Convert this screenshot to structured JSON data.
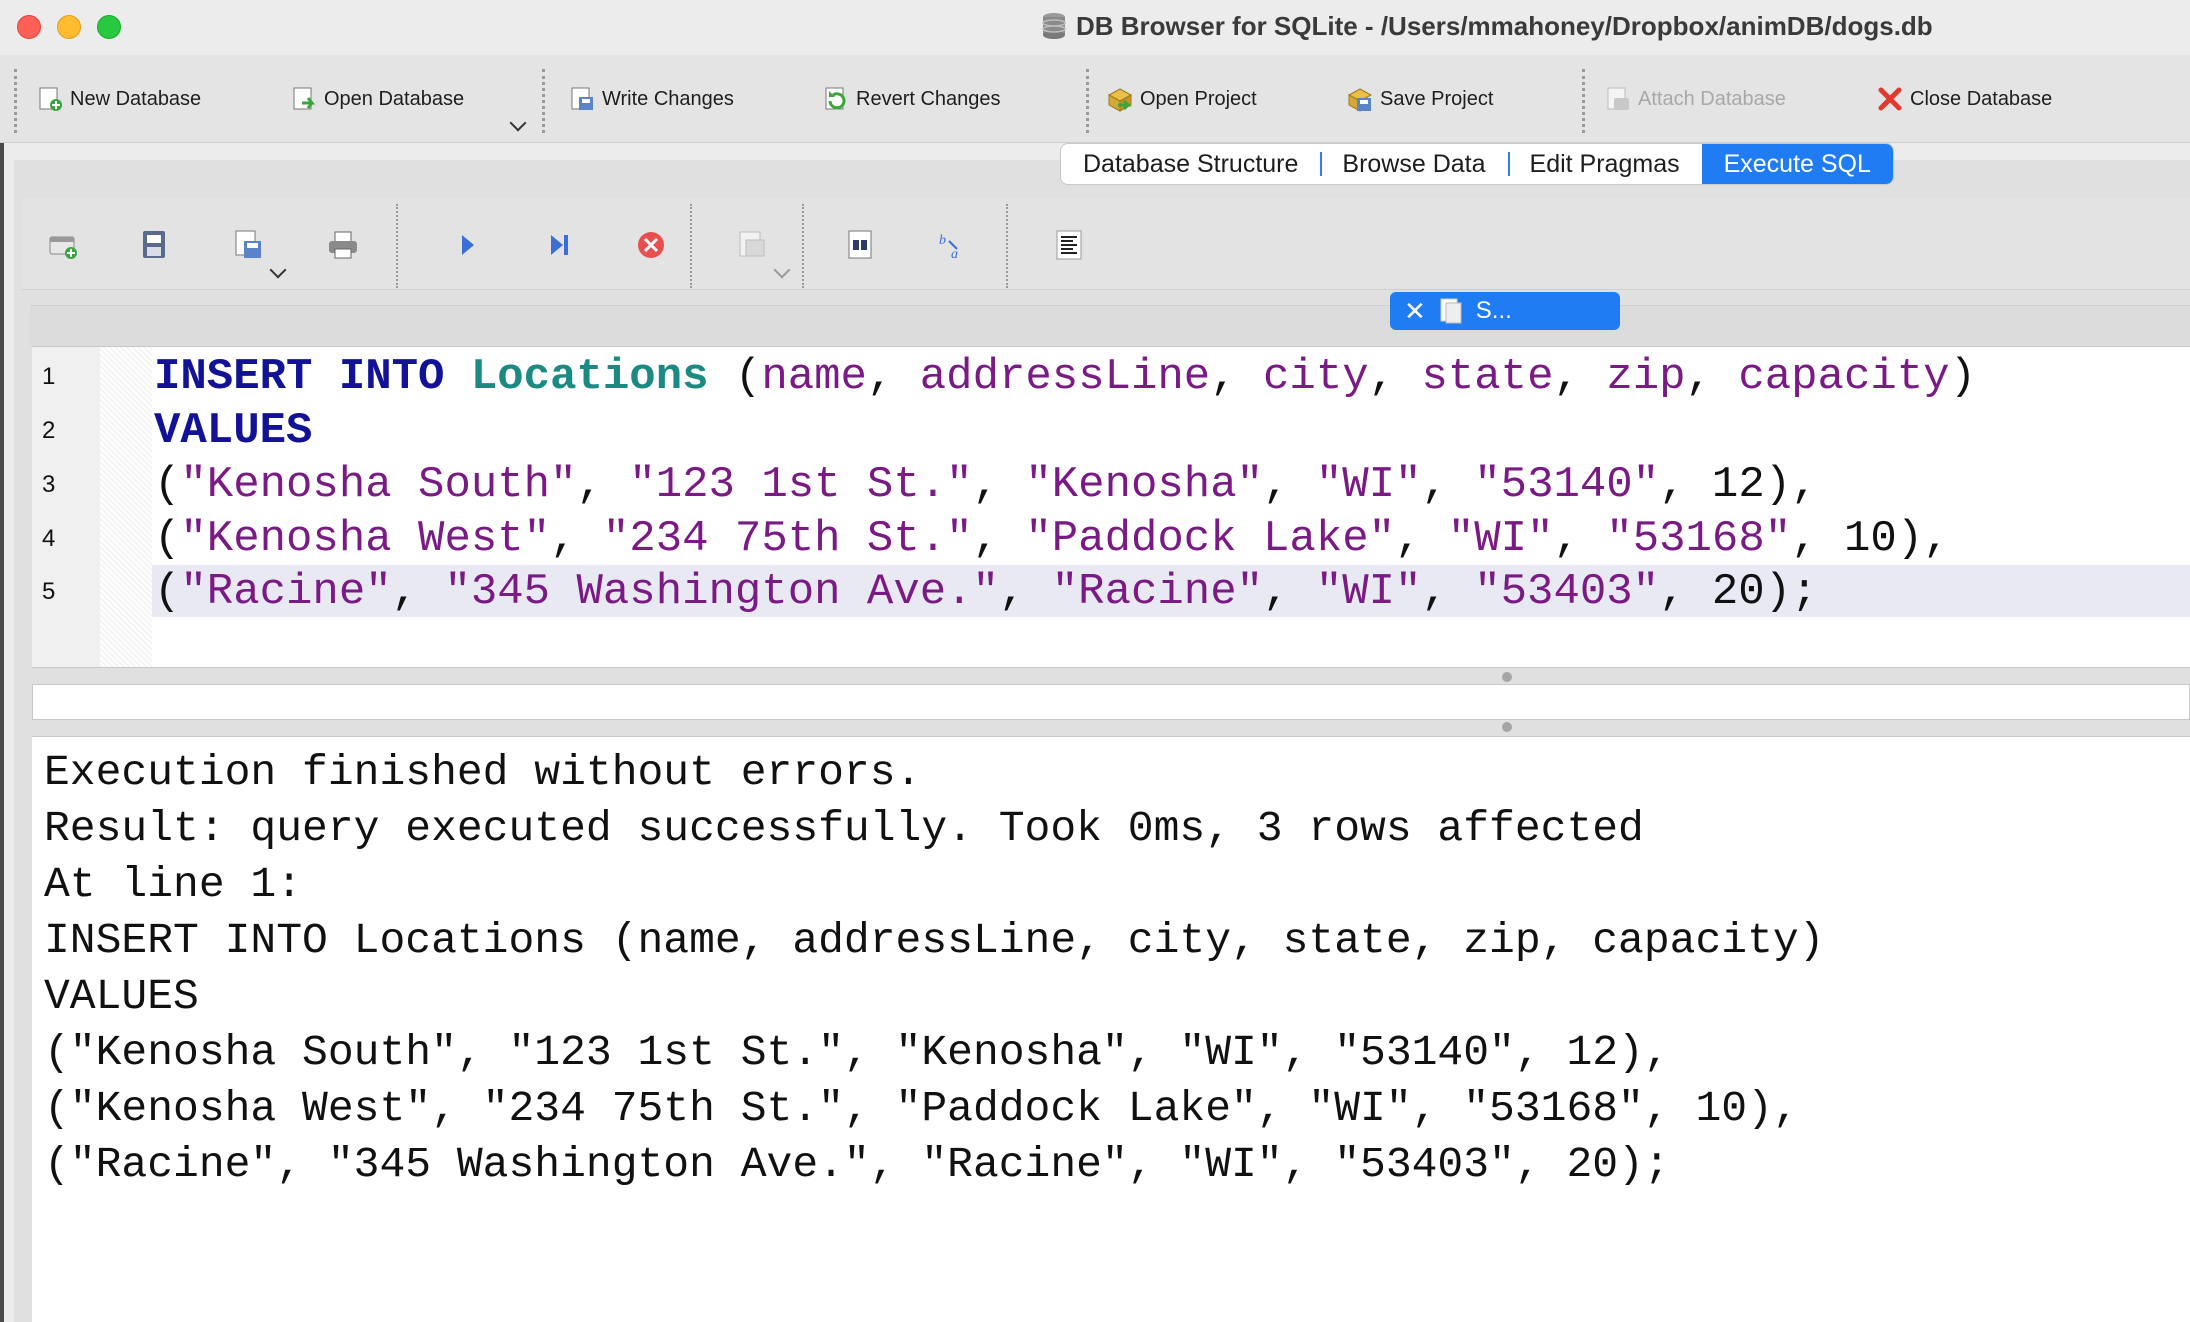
{
  "window": {
    "title": "DB Browser for SQLite - /Users/mmahoney/Dropbox/animDB/dogs.db"
  },
  "toolbar": {
    "new_database": "New Database",
    "open_database": "Open Database",
    "write_changes": "Write Changes",
    "revert_changes": "Revert Changes",
    "open_project": "Open Project",
    "save_project": "Save Project",
    "attach_database": "Attach Database",
    "close_database": "Close Database"
  },
  "tabs": [
    {
      "label": "Database Structure",
      "active": false
    },
    {
      "label": "Browse Data",
      "active": false
    },
    {
      "label": "Edit Pragmas",
      "active": false
    },
    {
      "label": "Execute SQL",
      "active": true
    }
  ],
  "editor_tab": {
    "label": "S..."
  },
  "editor": {
    "line_numbers": [
      "1",
      "2",
      "3",
      "4",
      "5"
    ],
    "lines": [
      {
        "kw1": "INSERT",
        "kw2": "INTO",
        "table": "Locations",
        "open": " (",
        "cols": [
          "name",
          "addressLine",
          "city",
          "state",
          "zip",
          "capacity"
        ],
        "close": ")"
      },
      {
        "kw": "VALUES"
      },
      {
        "values": [
          "\"Kenosha South\"",
          "\"123 1st St.\"",
          "\"Kenosha\"",
          "\"WI\"",
          "\"53140\""
        ],
        "number": "12",
        "end": "),"
      },
      {
        "values": [
          "\"Kenosha West\"",
          "\"234 75th St.\"",
          "\"Paddock Lake\"",
          "\"WI\"",
          "\"53168\""
        ],
        "number": "10",
        "end": "),"
      },
      {
        "values": [
          "\"Racine\"",
          "\"345 Washington Ave.\"",
          "\"Racine\"",
          "\"WI\"",
          "\"53403\""
        ],
        "number": "20",
        "end": ");"
      }
    ]
  },
  "output": {
    "lines": [
      "Execution finished without errors.",
      "Result: query executed successfully. Took 0ms, 3 rows affected",
      "At line 1:",
      "INSERT INTO Locations (name, addressLine, city, state, zip, capacity)",
      "VALUES",
      "(\"Kenosha South\", \"123 1st St.\", \"Kenosha\", \"WI\", \"53140\", 12),",
      "(\"Kenosha West\", \"234 75th St.\", \"Paddock Lake\", \"WI\", \"53168\", 10),",
      "(\"Racine\", \"345 Washington Ave.\", \"Racine\", \"WI\", \"53403\", 20);"
    ]
  },
  "colors": {
    "accent": "#1f7cf2",
    "keyword": "#121296",
    "table": "#1a8a82",
    "identifier": "#7a1a84"
  }
}
